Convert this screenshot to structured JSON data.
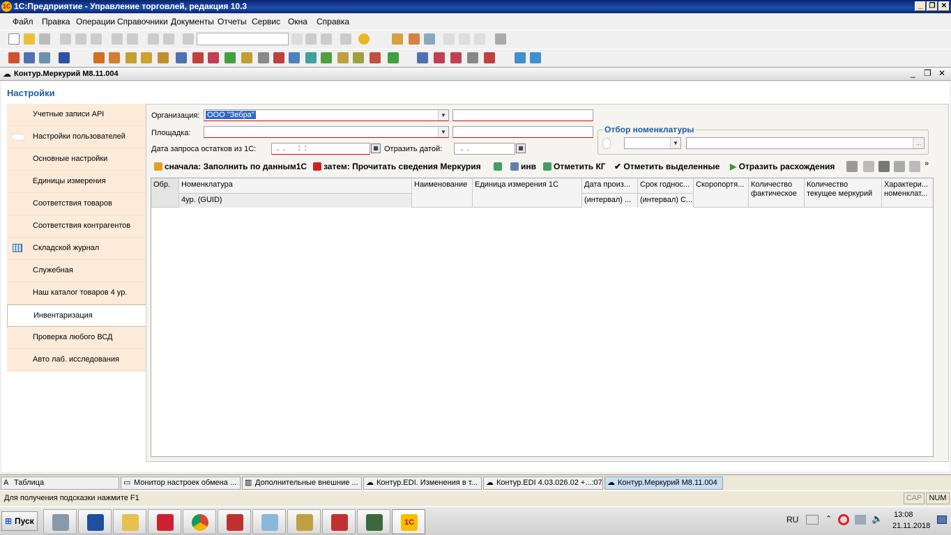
{
  "window": {
    "title": "1С:Предприятие - Управление торговлей, редакция 10.3"
  },
  "menu": [
    "Файл",
    "Правка",
    "Операции",
    "Справочники",
    "Документы",
    "Отчеты",
    "Сервис",
    "Окна",
    "Справка"
  ],
  "form": {
    "title": "Контур.Меркурий М8.11.004",
    "header": "Настройки",
    "nav": [
      {
        "label": "Учетные записи API"
      },
      {
        "label": "Настройки пользователей"
      },
      {
        "label": "Основные настройки"
      },
      {
        "label": "Единицы измерения"
      },
      {
        "label": "Соответствия товаров"
      },
      {
        "label": "Соответствия контрагентов"
      },
      {
        "label": "Складской журнал"
      },
      {
        "label": "Служебная"
      },
      {
        "label": "Наш каталог товаров 4 ур."
      },
      {
        "label": "Инвентаризация"
      },
      {
        "label": "Проверка любого ВСД"
      },
      {
        "label": "Авто лаб. исследования"
      }
    ],
    "organization": {
      "label": "Организация:",
      "value": "ООО \"Зебра\""
    },
    "site": {
      "label": "Площадка:",
      "value": ""
    },
    "date_request": {
      "label": "Дата запроса остатков из 1С:",
      "value": " .  .      :  :"
    },
    "reflect_date": {
      "label": "Отразить датой:",
      "value": " .  ."
    },
    "filter": {
      "legend": "Отбор номенклатуры"
    },
    "actions": {
      "first": "сначала: Заполнить по данным1С",
      "then": "затем: Прочитать сведения Меркурия",
      "inv": "инв",
      "mark_kg": "Отметить КГ",
      "mark_selected": "Отметить выделенные",
      "reflect_diff": "Отразить расхождения"
    },
    "grid": {
      "columns": [
        {
          "h1": "Обр.",
          "h2": ""
        },
        {
          "h1": "Номенклатура",
          "h2": "4ур. (GUID)"
        },
        {
          "h1": "Наименование",
          "h2": ""
        },
        {
          "h1": "Единица измерения 1С",
          "h2": ""
        },
        {
          "h1": "Дата произ...",
          "h2": "(интервал) ..."
        },
        {
          "h1": "Срок годнос...",
          "h2": "(интервал) С..."
        },
        {
          "h1": "Скоропортя...",
          "h2": ""
        },
        {
          "h1": "Количество",
          "h2": "фактическое"
        },
        {
          "h1": "Количество",
          "h2": "текущее меркурий"
        },
        {
          "h1": "Характери...",
          "h2": "номенклат..."
        }
      ]
    }
  },
  "open_windows": [
    {
      "label": "Таблица"
    },
    {
      "label": "Монитор настроек обмена ..."
    },
    {
      "label": "Дополнительные внешние ..."
    },
    {
      "label": "Контур.EDI. Изменения в т..."
    },
    {
      "label": "Контур.EDI 4.03.026.02 +...:07"
    },
    {
      "label": "Контур.Меркурий М8.11.004"
    }
  ],
  "status": {
    "hint": "Для получения подсказки нажмите F1",
    "cap": "CAP",
    "num": "NUM"
  },
  "taskbar": {
    "start": "Пуск",
    "lang": "RU",
    "time": "13:08",
    "date": "21.11.2018"
  }
}
